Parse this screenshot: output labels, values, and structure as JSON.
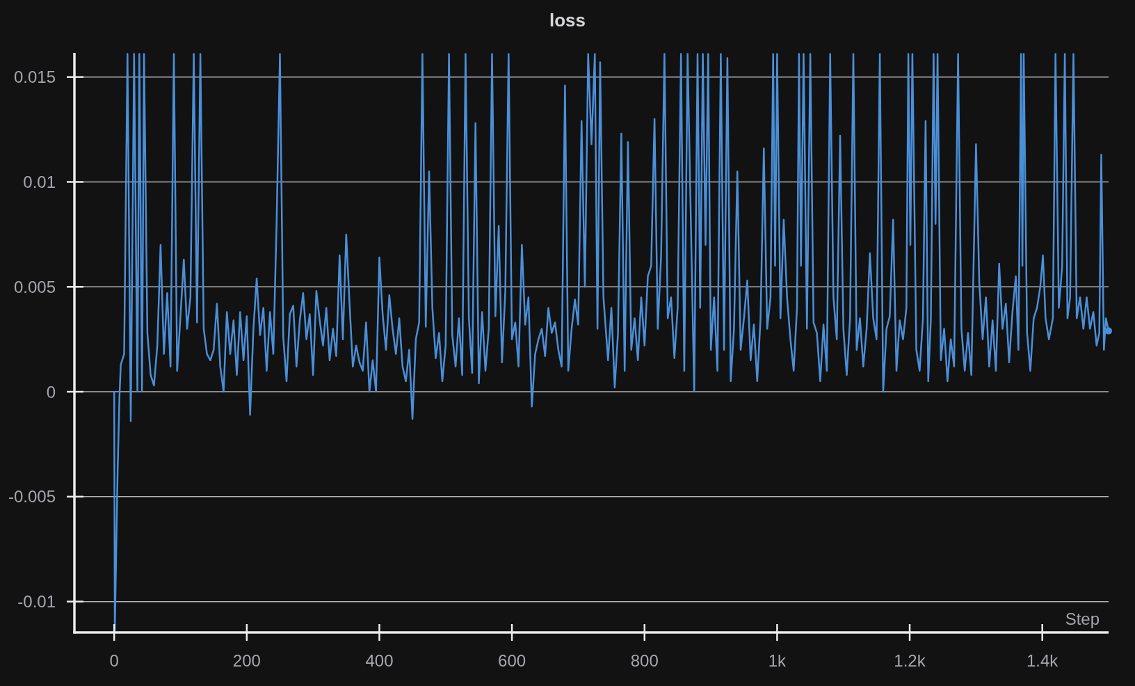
{
  "chart_data": {
    "type": "line",
    "title": "loss",
    "xlabel": "Step",
    "grid": true,
    "xlim": [
      -60,
      1500
    ],
    "ylim": [
      -0.01147,
      0.01615
    ],
    "xticks": [
      0,
      200,
      400,
      600,
      800,
      {
        "value": 1000,
        "label": "1k"
      },
      {
        "value": 1200,
        "label": "1.2k"
      },
      {
        "value": 1400,
        "label": "1.4k"
      }
    ],
    "yticks": [
      -0.01,
      -0.005,
      0,
      0.005,
      0.01,
      0.015
    ],
    "x": [
      0,
      1,
      5,
      8,
      10,
      15,
      20,
      25,
      30,
      35,
      38,
      42,
      45,
      50,
      55,
      60,
      65,
      70,
      75,
      80,
      85,
      90,
      95,
      100,
      105,
      110,
      115,
      120,
      125,
      130,
      135,
      140,
      145,
      150,
      155,
      160,
      165,
      170,
      175,
      180,
      185,
      190,
      195,
      200,
      205,
      210,
      215,
      220,
      225,
      230,
      235,
      240,
      245,
      250,
      255,
      260,
      265,
      270,
      275,
      280,
      285,
      290,
      295,
      300,
      305,
      310,
      315,
      320,
      325,
      330,
      335,
      340,
      345,
      350,
      355,
      360,
      365,
      370,
      375,
      380,
      385,
      390,
      395,
      400,
      405,
      410,
      415,
      420,
      425,
      430,
      435,
      440,
      445,
      450,
      455,
      460,
      465,
      470,
      475,
      480,
      485,
      490,
      495,
      500,
      505,
      510,
      515,
      520,
      525,
      530,
      535,
      540,
      545,
      550,
      555,
      560,
      565,
      570,
      575,
      580,
      585,
      590,
      595,
      600,
      605,
      610,
      615,
      620,
      625,
      630,
      635,
      640,
      645,
      650,
      655,
      660,
      665,
      670,
      675,
      680,
      685,
      690,
      695,
      700,
      705,
      710,
      715,
      720,
      725,
      729,
      733,
      738,
      745,
      750,
      755,
      760,
      765,
      770,
      775,
      780,
      785,
      790,
      795,
      800,
      805,
      810,
      815,
      820,
      825,
      830,
      835,
      840,
      845,
      850,
      855,
      860,
      865,
      870,
      875,
      880,
      884,
      888,
      892,
      896,
      900,
      905,
      910,
      915,
      920,
      925,
      930,
      935,
      940,
      945,
      950,
      955,
      960,
      965,
      970,
      975,
      980,
      985,
      990,
      994,
      997,
      1000,
      1005,
      1010,
      1015,
      1020,
      1025,
      1030,
      1033,
      1036,
      1040,
      1045,
      1050,
      1055,
      1060,
      1065,
      1070,
      1075,
      1080,
      1085,
      1090,
      1095,
      1100,
      1105,
      1110,
      1115,
      1120,
      1125,
      1130,
      1135,
      1140,
      1145,
      1150,
      1155,
      1160,
      1165,
      1170,
      1175,
      1180,
      1185,
      1190,
      1195,
      1198,
      1201,
      1204,
      1210,
      1215,
      1220,
      1224,
      1228,
      1232,
      1236,
      1239,
      1242,
      1247,
      1252,
      1257,
      1262,
      1267,
      1273,
      1278,
      1283,
      1288,
      1293,
      1300,
      1305,
      1310,
      1315,
      1320,
      1325,
      1330,
      1335,
      1340,
      1345,
      1350,
      1355,
      1360,
      1364,
      1368,
      1370,
      1372,
      1377,
      1382,
      1387,
      1392,
      1397,
      1401,
      1405,
      1410,
      1416,
      1420,
      1425,
      1430,
      1434,
      1438,
      1442,
      1447,
      1452,
      1457,
      1462,
      1467,
      1472,
      1477,
      1482,
      1486,
      1489,
      1493,
      1496,
      1500
    ],
    "series": [
      {
        "color": "#4a8fd8",
        "values": [
          0,
          -0.0114,
          -0.004,
          -0.0002,
          0.0013,
          0.0018,
          0.0161,
          -0.0014,
          0.0161,
          0,
          0.0161,
          0,
          0.0161,
          0.0028,
          0.0008,
          0.0003,
          0.0022,
          0.007,
          0.0018,
          0.0047,
          0.0012,
          0.0161,
          0.001,
          0.0036,
          0.0063,
          0.003,
          0.0045,
          0.0161,
          0.0033,
          0.0161,
          0.003,
          0.0018,
          0.0015,
          0.002,
          0.0042,
          0.0012,
          0,
          0.0038,
          0.0018,
          0.0034,
          0.0008,
          0.0038,
          0.0015,
          0.0036,
          -0.0011,
          0.003,
          0.0054,
          0.0027,
          0.004,
          0.001,
          0.0038,
          0.0018,
          0.008,
          0.0161,
          0.0026,
          0.0005,
          0.0037,
          0.0041,
          0.0012,
          0.0034,
          0.0047,
          0.0025,
          0.0037,
          0.0008,
          0.0048,
          0.0034,
          0.0022,
          0.004,
          0.0015,
          0.003,
          0.0017,
          0.0065,
          0.0025,
          0.0075,
          0.0042,
          0.0012,
          0.0022,
          0.0014,
          0.001,
          0.0033,
          0,
          0.0015,
          0,
          0.0064,
          0.0037,
          0.002,
          0.0046,
          0.003,
          0.0018,
          0.0035,
          0.0012,
          0.0005,
          0.002,
          -0.0013,
          0.0025,
          0.0033,
          0.0161,
          0.0031,
          0.0105,
          0.004,
          0.0016,
          0.0028,
          0.0005,
          0.0022,
          0.0161,
          0.0027,
          0.0012,
          0.0035,
          0.0008,
          0.0161,
          0.0035,
          0.0009,
          0.0128,
          0.0004,
          0.0038,
          0.001,
          0.003,
          0.0161,
          0.0036,
          0.0079,
          0.0014,
          0.0048,
          0.0161,
          0.0025,
          0.0033,
          0.0012,
          0.007,
          0.0032,
          0.0045,
          -0.0007,
          0.0018,
          0.0025,
          0.003,
          0.0017,
          0.004,
          0.0028,
          0.0033,
          0.002,
          0.0012,
          0.0146,
          0.001,
          0.003,
          0.0044,
          0.0032,
          0.0129,
          0.005,
          0.0161,
          0.0118,
          0.0161,
          0.003,
          0.0157,
          0.0045,
          0.0015,
          0.004,
          0.0002,
          0.0028,
          0.0123,
          0.001,
          0.0119,
          0.002,
          0.0035,
          0.0015,
          0.0045,
          0.0022,
          0.0055,
          0.006,
          0.013,
          0.003,
          0.0065,
          0.0161,
          0.0035,
          0.0045,
          0.0016,
          0.004,
          0.0161,
          0.001,
          0.0161,
          0.0079,
          0,
          0.0161,
          0.004,
          0.0161,
          0.007,
          0.0161,
          0.002,
          0.0045,
          0.001,
          0.0161,
          0.002,
          0.0159,
          0.0005,
          0.003,
          0.0105,
          0.002,
          0.0035,
          0.0053,
          0.0015,
          0.0032,
          0.0005,
          0.0035,
          0.0116,
          0.003,
          0.0045,
          0.0161,
          0.006,
          0.0161,
          0.0035,
          0.0082,
          0.0045,
          0.0025,
          0.001,
          0.004,
          0.0161,
          0.006,
          0.0161,
          0.003,
          0.0161,
          0.0033,
          0.0028,
          0.0005,
          0.0032,
          0.001,
          0.0161,
          0.0045,
          0.0025,
          0.0122,
          0.003,
          0.0008,
          0.0035,
          0.0161,
          0.002,
          0.0035,
          0.0012,
          0.003,
          0.0066,
          0.0035,
          0.0025,
          0.0161,
          0,
          0.003,
          0.0036,
          0.0082,
          0.001,
          0.0034,
          0.0025,
          0.004,
          0.0161,
          0.007,
          0.0161,
          0.002,
          0.001,
          0.0035,
          0.0129,
          0.0005,
          0.0035,
          0.0161,
          0.008,
          0.0161,
          0.0015,
          0.003,
          0.0005,
          0.0025,
          0.0012,
          0.0161,
          0.003,
          0.001,
          0.0028,
          0.0008,
          0.0118,
          0.0052,
          0.0025,
          0.0045,
          0.0012,
          0.0034,
          0.001,
          0.0061,
          0.003,
          0.0042,
          0.0014,
          0.0038,
          0.0055,
          0.002,
          0.0161,
          0.006,
          0.0161,
          0.0028,
          0.001,
          0.0035,
          0.004,
          0.005,
          0.0065,
          0.0035,
          0.0025,
          0.0035,
          0.0161,
          0.004,
          0.006,
          0.0161,
          0.0035,
          0.0045,
          0.0161,
          0.0035,
          0.0045,
          0.003,
          0.0045,
          0.003,
          0.0038,
          0.0022,
          0.0028,
          0.0113,
          0.002,
          0.0035,
          0.0029
        ]
      }
    ]
  }
}
